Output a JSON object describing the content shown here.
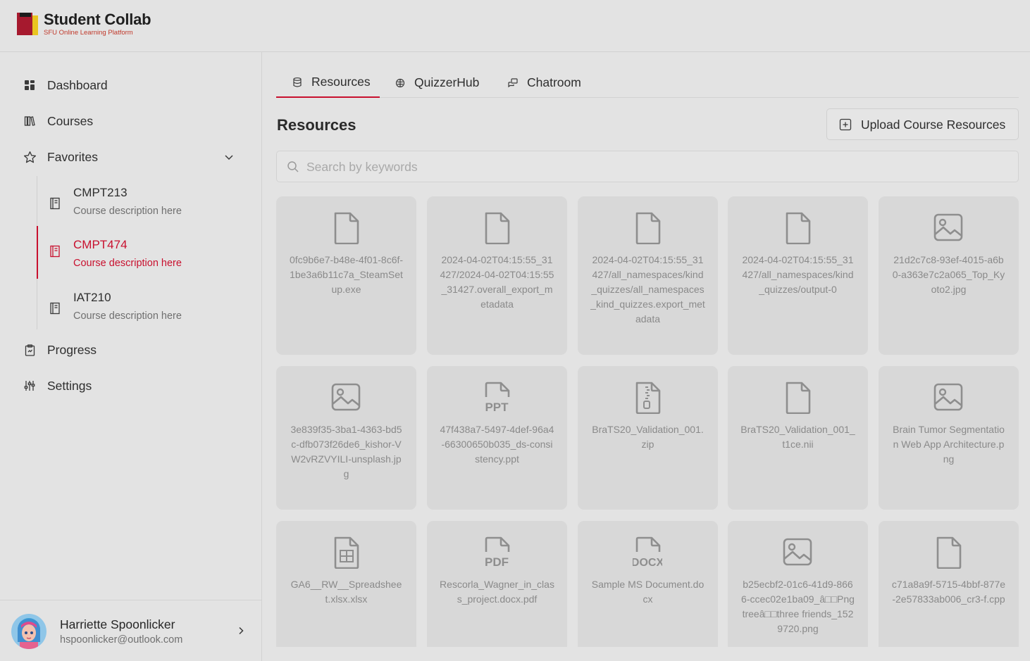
{
  "app": {
    "title": "Student Collab",
    "subtitle": "SFU Online Learning Platform"
  },
  "nav": {
    "dashboard": "Dashboard",
    "courses": "Courses",
    "favorites": "Favorites",
    "progress": "Progress",
    "settings": "Settings"
  },
  "favorites": [
    {
      "code": "CMPT213",
      "desc": "Course description here"
    },
    {
      "code": "CMPT474",
      "desc": "Course description here"
    },
    {
      "code": "IAT210",
      "desc": "Course description here"
    }
  ],
  "user": {
    "name": "Harriette Spoonlicker",
    "email": "hspoonlicker@outlook.com"
  },
  "tabs": {
    "resources": "Resources",
    "quizzerhub": "QuizzerHub",
    "chatroom": "Chatroom"
  },
  "main": {
    "title": "Resources",
    "upload_label": "Upload Course Resources",
    "search_placeholder": "Search by keywords"
  },
  "files": [
    {
      "name": "0fc9b6e7-b48e-4f01-8c6f-1be3a6b11c7a_SteamSetup.exe",
      "icon": "file-icon"
    },
    {
      "name": "2024-04-02T04:15:55_31427/2024-04-02T04:15:55_31427.overall_export_metadata",
      "icon": "file-icon"
    },
    {
      "name": "2024-04-02T04:15:55_31427/all_namespaces/kind_quizzes/all_namespaces_kind_quizzes.export_metadata",
      "icon": "file-icon"
    },
    {
      "name": "2024-04-02T04:15:55_31427/all_namespaces/kind_quizzes/output-0",
      "icon": "file-icon"
    },
    {
      "name": "21d2c7c8-93ef-4015-a6b0-a363e7c2a065_Top_Kyoto2.jpg",
      "icon": "image-icon"
    },
    {
      "name": "3e839f35-3ba1-4363-bd5c-dfb073f26de6_kishor-VW2vRZVYILI-unsplash.jpg",
      "icon": "image-icon"
    },
    {
      "name": "47f438a7-5497-4def-96a4-66300650b035_ds-consistency.ppt",
      "icon": "ppt-icon"
    },
    {
      "name": "BraTS20_Validation_001.zip",
      "icon": "zip-icon"
    },
    {
      "name": "BraTS20_Validation_001_t1ce.nii",
      "icon": "file-icon"
    },
    {
      "name": "Brain Tumor Segmentation Web App Architecture.png",
      "icon": "image-icon"
    },
    {
      "name": "GA6__RW__Spreadsheet.xlsx.xlsx",
      "icon": "spreadsheet-icon"
    },
    {
      "name": "Rescorla_Wagner_in_class_project.docx.pdf",
      "icon": "pdf-icon"
    },
    {
      "name": "Sample MS Document.docx",
      "icon": "docx-icon"
    },
    {
      "name": "b25ecbf2-01c6-41d9-8666-ccec02e1ba09_â□□Pngtreeâ□□three friends_1529720.png",
      "icon": "image-icon"
    },
    {
      "name": "c71a8a9f-5715-4bbf-877e-2e57833ab006_cr3-f.cpp",
      "icon": "file-icon"
    }
  ],
  "colors": {
    "accent": "#c8102e",
    "background": "#e3e3e3",
    "card": "#d8d8d8"
  }
}
